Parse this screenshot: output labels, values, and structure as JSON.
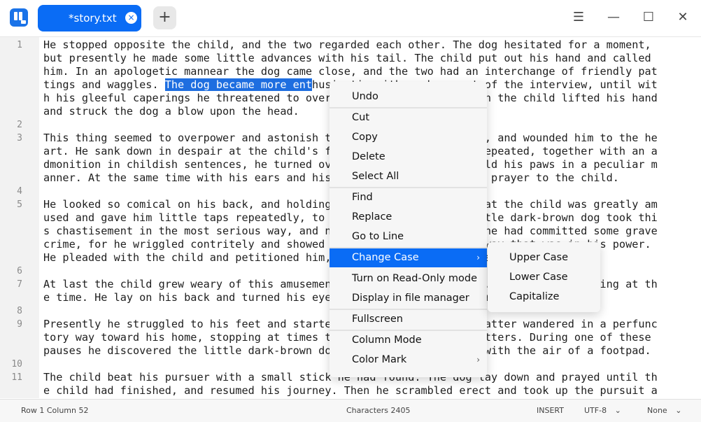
{
  "titlebar": {
    "tab_label": "*story.txt",
    "tab_close_glyph": "×",
    "add_tab_glyph": "+",
    "menu_glyph": "☰",
    "minimize_glyph": "—",
    "maximize_glyph": "☐",
    "close_glyph": "✕"
  },
  "editor": {
    "line_numbers": [
      "1",
      "2",
      "3",
      "4",
      "5",
      "6",
      "7",
      "8",
      "9",
      "10",
      "11"
    ],
    "selection_start": 52,
    "lines": [
      "He stopped opposite the child, and the two regarded each other. The dog hesitated for a moment,",
      "but presently he made some little advances with his tail. The child put out his hand and called",
      "him. In an apologetic mannear the dog came close, and the two had an interchange of friendly pat",
      "tings and waggles. The dog became more enthusiastic with each moment of the interview, until wit",
      "h his gleeful caperings he threatened to overturn the child. Whereupon the child lifted his hand",
      "and struck the dog a blow upon the head.",
      "",
      "This thing seemed to overpower and astonish the little dark-brown dog, and wounded him to the he",
      "art. He sank down in despair at the child's feet. When the blow was repeated, together with an a",
      "dmonition in childish sentences, he turned over upon his back, and held his paws in a peculiar m",
      "anner. At the same time with his ears and his eyes he offered a small prayer to the child.",
      "",
      "He looked so comical on his back, and holding his paws peculiarly, that the child was greatly am",
      "used and gave him little taps repeatedly, to keep him so. But the little dark-brown dog took thi",
      "s chastisement in the most serious way, and no doubt considered that he had committed some grave",
      "crime, for he wriggled contritely and showed his repentance in every way that was in his power.",
      "He pleaded with the child and petitioned him, and offered more prayers.",
      "",
      "At last the child grew weary of this amusement and turned toward home. The dog was praying at th",
      "e time. He lay on his back and turned his eyes upon the retreating form.",
      "",
      "Presently he struggled to his feet and started after the child. The latter wandered in a perfunc",
      "tory way toward his home, stopping at times to investigate various matters. During one of these",
      "pauses he discovered the little dark-brown dog who was following him with the air of a footpad.",
      "",
      "The child beat his pursuer with a small stick he had found. The dog lay down and prayed until th",
      "e child had finished, and resumed his journey. Then he scrambled erect and took up the pursuit a"
    ]
  },
  "context_menu": {
    "items": [
      {
        "label": "Undo"
      },
      {
        "label": "Cut"
      },
      {
        "label": "Copy"
      },
      {
        "label": "Delete"
      },
      {
        "label": "Select All"
      },
      {
        "label": "Find"
      },
      {
        "label": "Replace"
      },
      {
        "label": "Go to Line"
      },
      {
        "label": "Change Case"
      },
      {
        "label": "Turn on Read-Only mode"
      },
      {
        "label": "Display in file manager"
      },
      {
        "label": "Fullscreen"
      },
      {
        "label": "Column Mode"
      },
      {
        "label": "Color Mark"
      }
    ],
    "submenu_arrow": "›"
  },
  "change_case_submenu": {
    "items": [
      {
        "label": "Upper Case"
      },
      {
        "label": "Lower Case"
      },
      {
        "label": "Capitalize"
      }
    ]
  },
  "statusbar": {
    "row_col": "Row 1  Column 52",
    "characters": "Characters 2405",
    "mode": "INSERT",
    "encoding": "UTF-8",
    "highlight": "None",
    "dropdown_glyph": "⌄"
  },
  "colors": {
    "accent": "#0a6cf5",
    "selection": "#1e6ee0"
  }
}
